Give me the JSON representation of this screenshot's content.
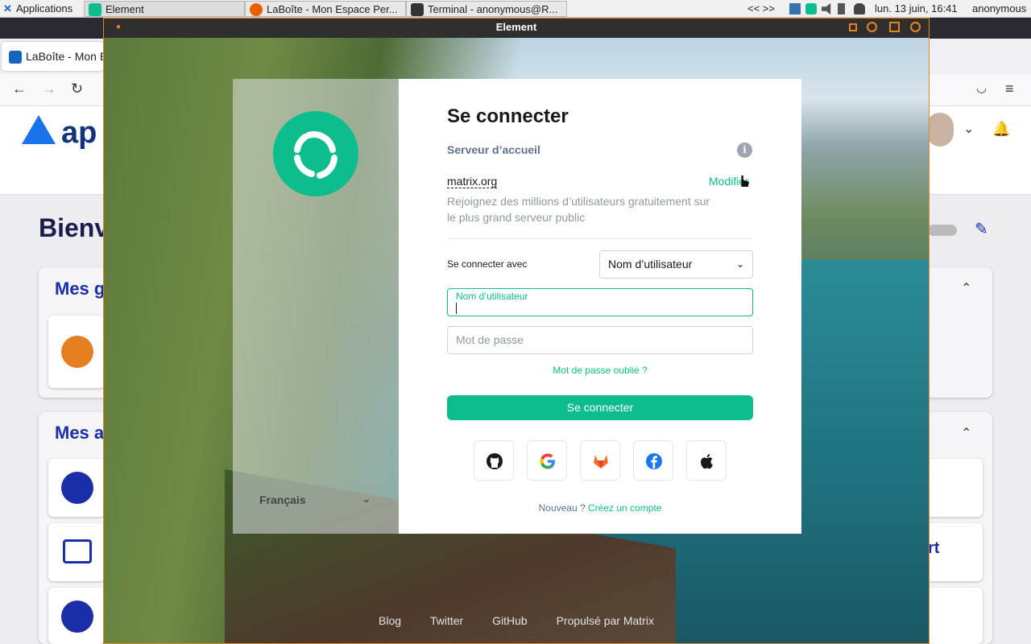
{
  "panel": {
    "apps_label": "Applications",
    "tasks": [
      {
        "label": "Element",
        "icon": "element-icon"
      },
      {
        "label": "LaBoîte - Mon Espace Per...",
        "icon": "firefox-icon"
      },
      {
        "label": "Terminal - anonymous@R...",
        "icon": "terminal-icon"
      }
    ],
    "tray_arrows": "<< >>",
    "clock": "lun. 13 juin, 16:41",
    "user": "anonymous"
  },
  "firefox": {
    "tab_title": "LaBoîte - Mon E",
    "site_logo": "ap",
    "welcome": "Bienv",
    "section1_title": "Mes g",
    "section2_title": "Mes a",
    "partial_text": "rt"
  },
  "element": {
    "window_title": "Element",
    "login": {
      "title": "Se connecter",
      "homeserver_label": "Serveur d’accueil",
      "server": "matrix.org",
      "modify": "Modifier",
      "server_desc": "Rejoignez des millions d’utilisateurs gratuitement sur le plus grand serveur public",
      "connect_with_label": "Se connecter avec",
      "connect_with_value": "Nom d’utilisateur",
      "username_placeholder": "Nom d’utilisateur",
      "password_placeholder": "Mot de passe",
      "forgot": "Mot de passe oublié ?",
      "submit": "Se connecter",
      "sso": [
        "github-icon",
        "google-icon",
        "gitlab-icon",
        "facebook-icon",
        "apple-icon"
      ],
      "new_label": "Nouveau ?",
      "create_account": "Créez un compte"
    },
    "language": "Français",
    "footer": [
      "Blog",
      "Twitter",
      "GitHub",
      "Propulsé par Matrix"
    ]
  },
  "colors": {
    "accent": "#0dbd8b",
    "window_border": "#e8841e"
  }
}
